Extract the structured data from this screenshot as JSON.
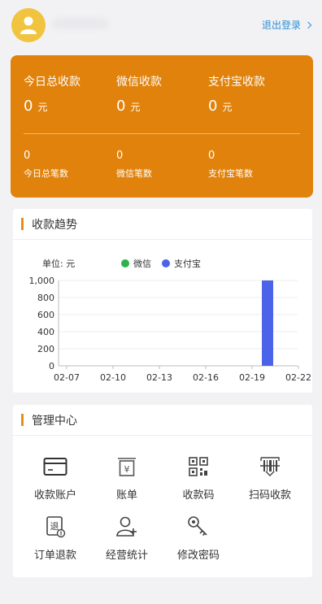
{
  "header": {
    "logout_label": "退出登录"
  },
  "summary": {
    "stats": [
      {
        "label": "今日总收款",
        "value": "0",
        "unit": "元"
      },
      {
        "label": "微信收款",
        "value": "0",
        "unit": "元"
      },
      {
        "label": "支付宝收款",
        "value": "0",
        "unit": "元"
      }
    ],
    "counts": [
      {
        "value": "0",
        "label": "今日总笔数"
      },
      {
        "value": "0",
        "label": "微信笔数"
      },
      {
        "value": "0",
        "label": "支付宝笔数"
      }
    ]
  },
  "trend": {
    "title": "收款趋势"
  },
  "chart_data": {
    "type": "bar",
    "unit_label": "单位: 元",
    "x_ticks": [
      "02-07",
      "02-10",
      "02-13",
      "02-16",
      "02-19",
      "02-22"
    ],
    "y_ticks": [
      "0",
      "200",
      "400",
      "600",
      "800",
      "1,000"
    ],
    "ylim": [
      0,
      1000
    ],
    "series": [
      {
        "name": "微信",
        "color": "#2db34a",
        "points": []
      },
      {
        "name": "支付宝",
        "color": "#4a63e8",
        "points": [
          {
            "x": "02-20",
            "y": 1000
          }
        ]
      }
    ],
    "legend": "top",
    "grid": true
  },
  "management": {
    "title": "管理中心",
    "items": [
      {
        "label": "收款账户",
        "icon": "card-icon"
      },
      {
        "label": "账单",
        "icon": "bill-icon"
      },
      {
        "label": "收款码",
        "icon": "qr-code-icon"
      },
      {
        "label": "扫码收款",
        "icon": "barcode-scan-icon"
      },
      {
        "label": "订单退款",
        "icon": "refund-icon"
      },
      {
        "label": "经营统计",
        "icon": "user-stats-icon"
      },
      {
        "label": "修改密码",
        "icon": "key-icon"
      }
    ]
  }
}
